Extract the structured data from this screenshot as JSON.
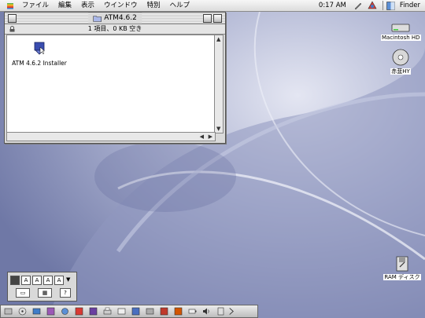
{
  "menubar": {
    "menus": [
      "ファイル",
      "編集",
      "表示",
      "ウインドウ",
      "特別",
      "ヘルプ"
    ],
    "clock": "0:17 AM",
    "app": "Finder"
  },
  "window": {
    "title": "ATM4.6.2",
    "info": "1 項目、0 KB 空き",
    "items": [
      {
        "label": "ATM 4.6.2 Installer",
        "icon": "installer-icon"
      }
    ]
  },
  "desktop": {
    "icons": [
      {
        "label": "Macintosh HD",
        "icon": "hard-disk-icon"
      },
      {
        "label": "赤韮HY",
        "icon": "cd-disc-icon"
      },
      {
        "label": "RAM ディスク",
        "icon": "ram-disk-icon"
      }
    ]
  },
  "panel": {
    "buttons": [
      "A",
      "A",
      "A",
      "A"
    ]
  },
  "colors": {
    "desktop": "#9aa3c4",
    "menubar": "#e8e8e8",
    "highlight": "#3a4db0"
  }
}
